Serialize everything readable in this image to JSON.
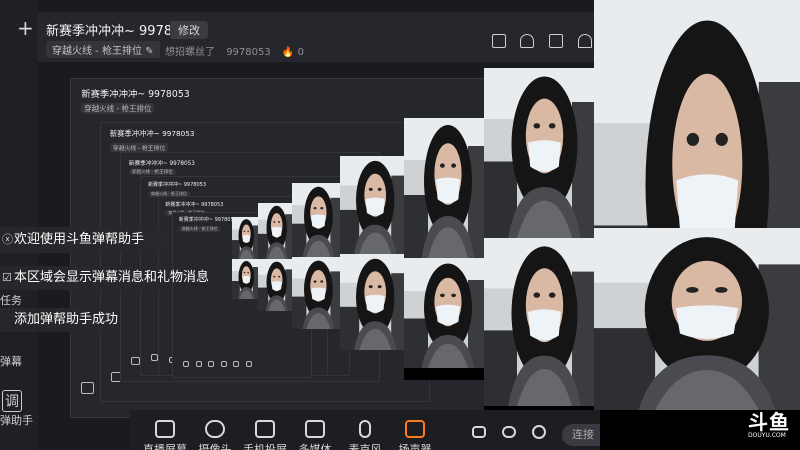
{
  "stream": {
    "title": "新赛季冲冲冲~ 9978053",
    "edit_label": "修改",
    "category": "穿越火线 - 枪王排位",
    "status": "想招螺丝了",
    "room_id": "9978053",
    "heat": "0"
  },
  "toolbar": {
    "items": [
      {
        "label": "直播屏幕",
        "icon": "screen-share-icon"
      },
      {
        "label": "摄像头",
        "icon": "camera-icon"
      },
      {
        "label": "手机投屏",
        "icon": "phone-cast-icon"
      },
      {
        "label": "多媒体",
        "icon": "media-icon"
      },
      {
        "label": "麦克风",
        "icon": "microphone-icon"
      },
      {
        "label": "扬声器",
        "icon": "speaker-icon"
      }
    ],
    "partial_button": "连接"
  },
  "notifications": [
    "欢迎使用斗鱼弹帮助手",
    "本区域会显示弹幕消息和礼物消息",
    "添加弹帮助手成功"
  ],
  "sidebar": {
    "add_symbol": "+",
    "labels": [
      "任务",
      "弹幕",
      "调",
      "弹助手"
    ]
  },
  "watermark": {
    "logo": "斗鱼",
    "url": "DOUYU.COM"
  },
  "colors": {
    "background": "#1a1b1f",
    "panel": "#26272c",
    "accent_orange": "#ff7a1a"
  }
}
